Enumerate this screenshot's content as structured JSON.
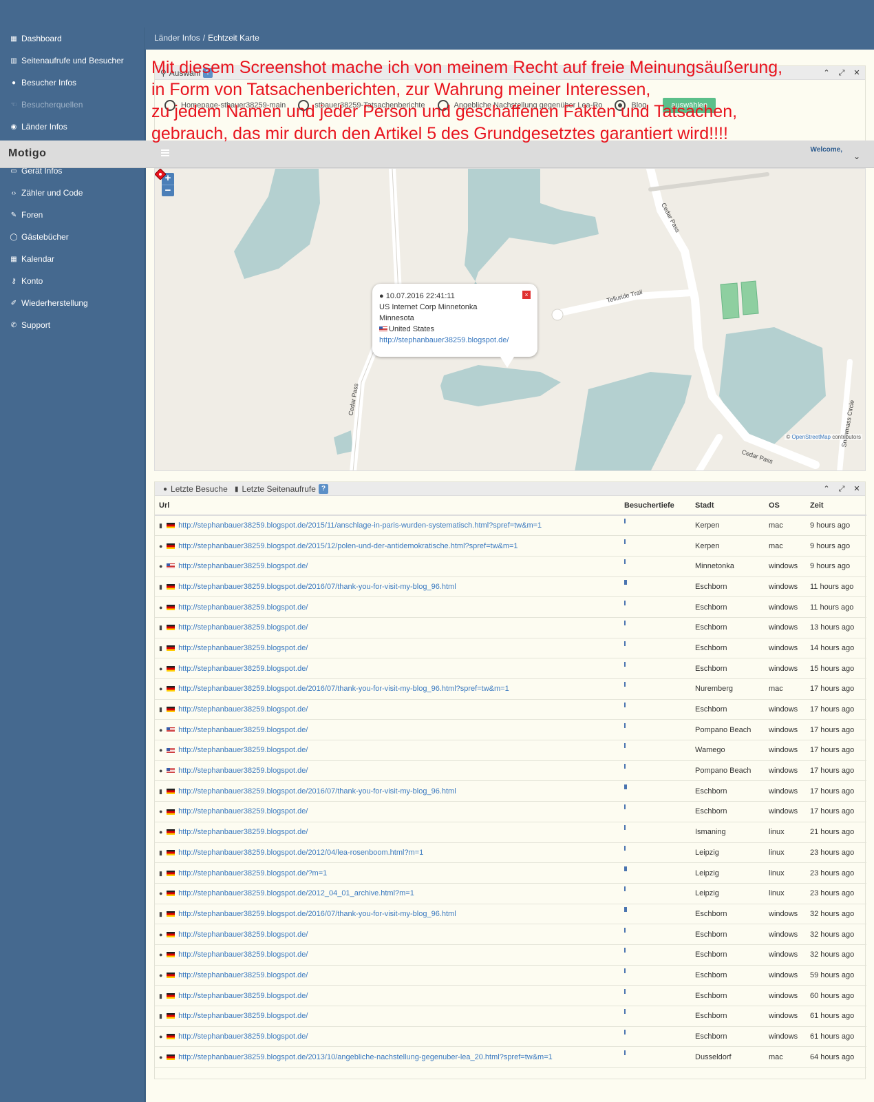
{
  "sidebar": {
    "items": [
      {
        "label": "Dashboard",
        "icon": "table-icon",
        "muted": false
      },
      {
        "label": "Seitenaufrufe und Besucher",
        "icon": "bar-chart-icon",
        "muted": false
      },
      {
        "label": "Besucher Infos",
        "icon": "user-icon",
        "muted": false
      },
      {
        "label": "Besucherquellen",
        "icon": "thumbs-icon",
        "muted": true
      },
      {
        "label": "Länder Infos",
        "icon": "globe-icon",
        "muted": false
      },
      {
        "label": "Gerät Infos",
        "icon": "desktop-icon",
        "muted": false
      },
      {
        "label": "Zähler und Code",
        "icon": "code-icon",
        "muted": false
      },
      {
        "label": "Foren",
        "icon": "edit-icon",
        "muted": false
      },
      {
        "label": "Gästebücher",
        "icon": "comment-icon",
        "muted": false
      },
      {
        "label": "Kalendar",
        "icon": "calendar-icon",
        "muted": false
      },
      {
        "label": "Konto",
        "icon": "key-icon",
        "muted": false
      },
      {
        "label": "Wiederherstellung",
        "icon": "wrench-icon",
        "muted": false
      },
      {
        "label": "Support",
        "icon": "phone-icon",
        "muted": false
      }
    ]
  },
  "header": {
    "breadcrumb_parent": "Länder Infos",
    "breadcrumb_sep": "/",
    "breadcrumb_current": "Echtzeit Karte"
  },
  "topbar": {
    "brand": "Motigo",
    "welcome": "Welcome,"
  },
  "overlay": {
    "lines": [
      "Mit diesem Screenshot mache ich von meinem Recht auf freie Meinungsäußerung,",
      "in Form von Tatsachenberichten, zur Wahrung meiner Interessen,",
      "zu jedem Namen und jeder Person und geschaffenen Fakten und Tatsachen,",
      "gebrauch, das mir durch den Artikel 5 des Grundgesetztes garantiert wird!!!!"
    ],
    "color": "#e8141e"
  },
  "auswahl": {
    "title": "Auswahl",
    "help": "?",
    "options": [
      {
        "label": "Homepage-stbauer38259-main",
        "selected": false
      },
      {
        "label": "stbauer38259-Tatsachenberichte",
        "selected": false
      },
      {
        "label": "Angebliche Nachstellung gegenüber Lea-Ro",
        "selected": false
      },
      {
        "label": "Blog",
        "selected": true
      }
    ],
    "button": "auswählen"
  },
  "map": {
    "zoom_in": "+",
    "zoom_out": "−",
    "attribution_prefix": "©",
    "attribution_link": "OpenStreetMap",
    "attribution_suffix": "contributors",
    "roads": {
      "cedar_pass": "Cedar Pass",
      "telluride": "Telluride Trail",
      "snowmass": "Snowmass Circle"
    },
    "popup": {
      "datetime": "10.07.2016 22:41:11",
      "org": "US Internet Corp Minnetonka",
      "region": "Minnesota",
      "country": "United States",
      "link": "http://stephanbauer38259.blogspot.de/",
      "close": "×"
    }
  },
  "visits": {
    "tab_visits": "Letzte Besuche",
    "tab_pages": "Letzte Seitenaufrufe",
    "help": "?",
    "columns": [
      "Url",
      "Besuchertiefe",
      "Stadt",
      "OS",
      "Zeit"
    ],
    "rows": [
      {
        "type": "page",
        "flag": "de",
        "url": "http://stephanbauer38259.blogspot.de/2015/11/anschlage-in-paris-wurden-systematisch.html?spref=tw&m=1",
        "depth": 1,
        "city": "Kerpen",
        "os": "mac",
        "time": "9 hours ago"
      },
      {
        "type": "user",
        "flag": "de",
        "url": "http://stephanbauer38259.blogspot.de/2015/12/polen-und-der-antidemokratische.html?spref=tw&m=1",
        "depth": 1,
        "city": "Kerpen",
        "os": "mac",
        "time": "9 hours ago"
      },
      {
        "type": "user",
        "flag": "us",
        "url": "http://stephanbauer38259.blogspot.de/",
        "depth": 1,
        "city": "Minnetonka",
        "os": "windows",
        "time": "9 hours ago"
      },
      {
        "type": "page",
        "flag": "de",
        "url": "http://stephanbauer38259.blogspot.de/2016/07/thank-you-for-visit-my-blog_96.html",
        "depth": 2,
        "city": "Eschborn",
        "os": "windows",
        "time": "11 hours ago"
      },
      {
        "type": "user",
        "flag": "de",
        "url": "http://stephanbauer38259.blogspot.de/",
        "depth": 1,
        "city": "Eschborn",
        "os": "windows",
        "time": "11 hours ago"
      },
      {
        "type": "page",
        "flag": "de",
        "url": "http://stephanbauer38259.blogspot.de/",
        "depth": 1,
        "city": "Eschborn",
        "os": "windows",
        "time": "13 hours ago"
      },
      {
        "type": "page",
        "flag": "de",
        "url": "http://stephanbauer38259.blogspot.de/",
        "depth": 1,
        "city": "Eschborn",
        "os": "windows",
        "time": "14 hours ago"
      },
      {
        "type": "user",
        "flag": "de",
        "url": "http://stephanbauer38259.blogspot.de/",
        "depth": 1,
        "city": "Eschborn",
        "os": "windows",
        "time": "15 hours ago"
      },
      {
        "type": "user",
        "flag": "de",
        "url": "http://stephanbauer38259.blogspot.de/2016/07/thank-you-for-visit-my-blog_96.html?spref=tw&m=1",
        "depth": 1,
        "city": "Nuremberg",
        "os": "mac",
        "time": "17 hours ago"
      },
      {
        "type": "page",
        "flag": "de",
        "url": "http://stephanbauer38259.blogspot.de/",
        "depth": 1,
        "city": "Eschborn",
        "os": "windows",
        "time": "17 hours ago"
      },
      {
        "type": "user",
        "flag": "us",
        "url": "http://stephanbauer38259.blogspot.de/",
        "depth": 1,
        "city": "Pompano Beach",
        "os": "windows",
        "time": "17 hours ago"
      },
      {
        "type": "user",
        "flag": "us",
        "url": "http://stephanbauer38259.blogspot.de/",
        "depth": 1,
        "city": "Wamego",
        "os": "windows",
        "time": "17 hours ago"
      },
      {
        "type": "user",
        "flag": "us",
        "url": "http://stephanbauer38259.blogspot.de/",
        "depth": 1,
        "city": "Pompano Beach",
        "os": "windows",
        "time": "17 hours ago"
      },
      {
        "type": "page",
        "flag": "de",
        "url": "http://stephanbauer38259.blogspot.de/2016/07/thank-you-for-visit-my-blog_96.html",
        "depth": 2,
        "city": "Eschborn",
        "os": "windows",
        "time": "17 hours ago"
      },
      {
        "type": "user",
        "flag": "de",
        "url": "http://stephanbauer38259.blogspot.de/",
        "depth": 1,
        "city": "Eschborn",
        "os": "windows",
        "time": "17 hours ago"
      },
      {
        "type": "user",
        "flag": "de",
        "url": "http://stephanbauer38259.blogspot.de/",
        "depth": 1,
        "city": "Ismaning",
        "os": "linux",
        "time": "21 hours ago"
      },
      {
        "type": "page",
        "flag": "de",
        "url": "http://stephanbauer38259.blogspot.de/2012/04/lea-rosenboom.html?m=1",
        "depth": 1,
        "city": "Leipzig",
        "os": "linux",
        "time": "23 hours ago"
      },
      {
        "type": "page",
        "flag": "de",
        "url": "http://stephanbauer38259.blogspot.de/?m=1",
        "depth": 2,
        "city": "Leipzig",
        "os": "linux",
        "time": "23 hours ago"
      },
      {
        "type": "user",
        "flag": "de",
        "url": "http://stephanbauer38259.blogspot.de/2012_04_01_archive.html?m=1",
        "depth": 1,
        "city": "Leipzig",
        "os": "linux",
        "time": "23 hours ago"
      },
      {
        "type": "page",
        "flag": "de",
        "url": "http://stephanbauer38259.blogspot.de/2016/07/thank-you-for-visit-my-blog_96.html",
        "depth": 2,
        "city": "Eschborn",
        "os": "windows",
        "time": "32 hours ago"
      },
      {
        "type": "user",
        "flag": "de",
        "url": "http://stephanbauer38259.blogspot.de/",
        "depth": 1,
        "city": "Eschborn",
        "os": "windows",
        "time": "32 hours ago"
      },
      {
        "type": "user",
        "flag": "de",
        "url": "http://stephanbauer38259.blogspot.de/",
        "depth": 1,
        "city": "Eschborn",
        "os": "windows",
        "time": "32 hours ago"
      },
      {
        "type": "user",
        "flag": "de",
        "url": "http://stephanbauer38259.blogspot.de/",
        "depth": 1,
        "city": "Eschborn",
        "os": "windows",
        "time": "59 hours ago"
      },
      {
        "type": "page",
        "flag": "de",
        "url": "http://stephanbauer38259.blogspot.de/",
        "depth": 1,
        "city": "Eschborn",
        "os": "windows",
        "time": "60 hours ago"
      },
      {
        "type": "page",
        "flag": "de",
        "url": "http://stephanbauer38259.blogspot.de/",
        "depth": 1,
        "city": "Eschborn",
        "os": "windows",
        "time": "61 hours ago"
      },
      {
        "type": "user",
        "flag": "de",
        "url": "http://stephanbauer38259.blogspot.de/",
        "depth": 1,
        "city": "Eschborn",
        "os": "windows",
        "time": "61 hours ago"
      },
      {
        "type": "user",
        "flag": "de",
        "url": "http://stephanbauer38259.blogspot.de/2013/10/angebliche-nachstellung-gegenuber-lea_20.html?spref=tw&m=1",
        "depth": 1,
        "city": "Dusseldorf",
        "os": "mac",
        "time": "64 hours ago"
      }
    ]
  }
}
